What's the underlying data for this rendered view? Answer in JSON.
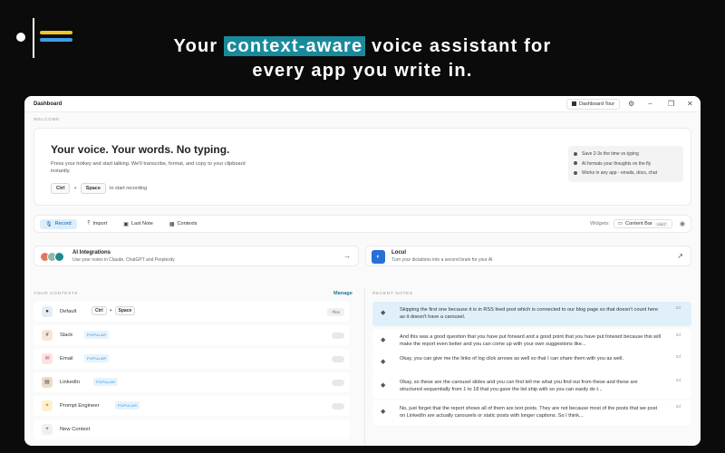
{
  "hero": {
    "pre": "Your ",
    "highlight": "context-aware",
    "post": " voice assistant for",
    "line2": "every app you write in."
  },
  "window": {
    "title": "Dashboard",
    "tour_label": "Dashboard Tour",
    "controls": [
      "−",
      "❐",
      "✕"
    ]
  },
  "welcome": {
    "label": "WELCOME",
    "title": "Your voice. Your words. No typing.",
    "description": "Press your hotkey and start talking. We'll transcribe, format, and copy to your clipboard instantly.",
    "key1": "Ctrl",
    "plus": "+",
    "key2": "Space",
    "hint": "to start recording",
    "benefits": [
      "Save 2-3x the time vs typing",
      "AI formats your thoughts on the fly",
      "Works in any app - emails, docs, chat"
    ]
  },
  "toolbar": {
    "buttons": [
      {
        "label": "Record",
        "icon": "mic-icon"
      },
      {
        "label": "Import",
        "icon": "upload-icon"
      },
      {
        "label": "Last Note",
        "icon": "note-icon"
      },
      {
        "label": "Contexts",
        "icon": "grid-icon"
      }
    ],
    "widgets_label": "Widgets:",
    "content_bar": "Content Bar",
    "content_bar_badge": "OMIT"
  },
  "integrations": {
    "ai": {
      "title": "AI Integrations",
      "subtitle": "Use your notes in Claude, ChatGPT and Perplexity"
    },
    "locul": {
      "title": "Locul",
      "subtitle": "Turn your dictations into a second brain for your AI"
    }
  },
  "contexts": {
    "label": "YOUR CONTEXTS",
    "manage": "Manage",
    "items": [
      {
        "name": "Default",
        "tag": "",
        "icon_color": "#d9e8f5",
        "icon": "●"
      },
      {
        "name": "Slack",
        "tag": "POPULAR",
        "icon_color": "#f5e6d9",
        "icon": "#"
      },
      {
        "name": "Email",
        "tag": "POPULAR",
        "icon_color": "#fbe3e3",
        "icon": "✉"
      },
      {
        "name": "LinkedIn",
        "tag": "POPULAR",
        "icon_color": "#e8dccd",
        "icon": "in"
      },
      {
        "name": "Prompt Engineer",
        "tag": "POPULAR",
        "icon_color": "#fbf0cf",
        "icon": "✦"
      }
    ],
    "default_keys": [
      "Ctrl",
      "+",
      "Space"
    ],
    "default_mode": "Flex",
    "new": "New Context"
  },
  "notes": {
    "label": "RECENT NOTES",
    "items": [
      {
        "text": "Skipping the first one because it is in RSS feed post which is connected to our blog page so that doesn't count here as it doesn't have a carousel.",
        "time": "2d"
      },
      {
        "text": "And this was a good question that you have put forward and a good point that you have put forward because this will make the report even better and you can come up with your own suggestions like...",
        "time": "2d"
      },
      {
        "text": "Okay, you can give me the links of log click arrows as well so that I can share them with you as well.",
        "time": "2d"
      },
      {
        "text": "Okay, so these are the carousel slides and you can first tell me what you find out from these and these are structured sequentially from 1 to 18 that you gave the list ship with so you can easily do t...",
        "time": "2d"
      },
      {
        "text": "No, just forget that the report shows all of them are text posts. They are not because most of the posts that we post on LinkedIn are actually carousels or static posts with longer captions. So I think...",
        "time": "2d"
      }
    ]
  }
}
